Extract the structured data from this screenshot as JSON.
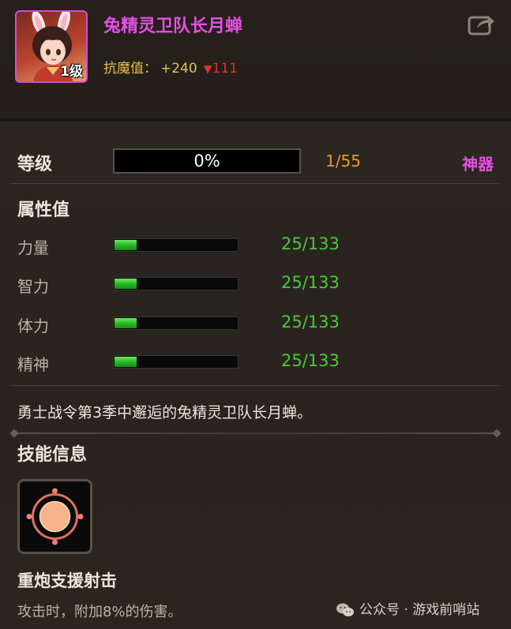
{
  "item": {
    "name": "兔精灵卫队长月蝉",
    "level_badge": "1级",
    "rarity_color": "#e84ee6",
    "share_icon": "share-icon"
  },
  "resist": {
    "label": "抗魔值：",
    "plus": "+240",
    "down_arrow": "▼",
    "down_value": "111"
  },
  "level": {
    "label": "等级",
    "progress_text": "0%",
    "progress_fraction": 0,
    "count": "1/55",
    "rarity": "神器"
  },
  "attributes": {
    "title": "属性值",
    "stats": [
      {
        "name": "力量",
        "value": "25/133",
        "fraction": 0.188
      },
      {
        "name": "智力",
        "value": "25/133",
        "fraction": 0.188
      },
      {
        "name": "体力",
        "value": "25/133",
        "fraction": 0.188
      },
      {
        "name": "精神",
        "value": "25/133",
        "fraction": 0.188
      }
    ]
  },
  "description": "勇士战令第3季中邂逅的兔精灵卫队长月蝉。",
  "skill": {
    "section_title": "技能信息",
    "icon": "sun-orb-icon",
    "name": "重炮支援射击",
    "desc": "攻击时，附加8%的伤害。"
  },
  "watermark": {
    "text": "公众号 · 游戏前哨站",
    "icon": "wechat-icon"
  },
  "colors": {
    "name": "#e84ee6",
    "resist_label": "#e8c04a",
    "resist_down": "#e0302a",
    "level_count": "#e89a2a",
    "stat_value": "#4ec83a"
  }
}
